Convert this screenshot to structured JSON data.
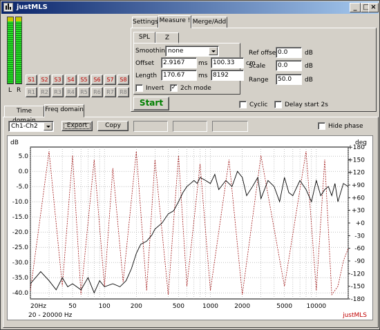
{
  "window": {
    "title": "justMLS",
    "controls": {
      "minimize": "_",
      "maximize": "□",
      "close": "×"
    }
  },
  "meters": {
    "left_label": "L",
    "right_label": "R"
  },
  "channel_buttons": {
    "s_row": [
      "S1",
      "S2",
      "S3",
      "S4",
      "S5",
      "S6",
      "S7",
      "S8"
    ],
    "r_row": [
      "R1",
      "R2",
      "R3",
      "R4",
      "R5",
      "R6",
      "R7",
      "R8"
    ]
  },
  "main_tabs": [
    "Settings",
    "Measure !",
    "Merge/Add"
  ],
  "sub_tabs": [
    "SPL",
    "Z"
  ],
  "measure": {
    "smoothing_label": "Smoothing",
    "smoothing_value": "none",
    "offset_label": "Offset",
    "offset_ms": "2.9167",
    "offset_ms_unit": "ms",
    "offset_cm": "100.33",
    "offset_cm_unit": "cm",
    "length_label": "Length",
    "length_ms": "170.67",
    "length_ms_unit": "ms",
    "length_samples": "8192",
    "invert_label": "Invert",
    "invert_checked": false,
    "twoch_label": "2ch mode",
    "twoch_checked": true,
    "ref_offset_label": "Ref offset",
    "ref_offset_value": "0.0",
    "scale_label": "Scale",
    "scale_value": "0.0",
    "range_label": "Range",
    "range_value": "50.0",
    "db_unit": "dB",
    "start_label": "Start",
    "cyclic_label": "Cyclic",
    "delay_label": "Delay start 2s"
  },
  "view_tabs": [
    "Time domain",
    "Freq domain"
  ],
  "toolbar": {
    "channel_value": "Ch1-Ch2",
    "export_label": "Export",
    "copy_label": "Copy",
    "hide_phase_label": "Hide phase"
  },
  "plot": {
    "y_left_title": "dB",
    "y_right_title": "deg",
    "y_left_ticks": [
      "5.0",
      "0.0",
      "-5.0",
      "-10.0",
      "-15.0",
      "-20.0",
      "-25.0",
      "-30.0",
      "-35.0",
      "-40.0"
    ],
    "y_right_ticks": [
      "+180",
      "+150",
      "+120",
      "+90",
      "+60",
      "+30",
      "+0",
      "-30",
      "-60",
      "-90",
      "-120",
      "-150",
      "-180"
    ],
    "x_ticks": [
      "20Hz",
      "50",
      "100",
      "200",
      "500",
      "1000",
      "2000",
      "5000",
      "10000"
    ],
    "range_caption": "20    - 20000 Hz",
    "brand": "justMLS",
    "colors": {
      "magnitude": "#000000",
      "phase": "#a01010",
      "brand": "#c00000"
    }
  },
  "chart_data": {
    "type": "line",
    "title": "",
    "xlabel": "",
    "ylabel": "dB",
    "y2label": "deg",
    "xscale": "log",
    "xlim": [
      20,
      20000
    ],
    "ylim": [
      -42,
      8
    ],
    "y2lim": [
      -180,
      180
    ],
    "grid": true,
    "series": [
      {
        "axis": "left",
        "x": [
          20,
          25,
          30,
          35,
          40,
          45,
          50,
          60,
          70,
          80,
          90,
          100,
          120,
          140,
          160,
          180,
          200,
          220,
          250,
          280,
          300,
          350,
          400,
          450,
          500,
          550,
          600,
          650,
          700,
          750,
          800,
          900,
          1000,
          1100,
          1200,
          1400,
          1600,
          1800,
          2000,
          2200,
          2500,
          2800,
          3000,
          3500,
          4000,
          4500,
          5000,
          5500,
          6000,
          7000,
          8000,
          9000,
          10000,
          11000,
          12000,
          13000,
          14000,
          15000,
          16000,
          18000,
          20000
        ],
        "y": [
          -37,
          -33,
          -36,
          -39,
          -35,
          -38,
          -37,
          -39,
          -35,
          -40,
          -36,
          -38,
          -37,
          -38,
          -36,
          -32,
          -27,
          -24,
          -23,
          -21,
          -19,
          -17,
          -14,
          -13,
          -10,
          -7,
          -5,
          -4,
          -3,
          -4,
          -2,
          -3,
          -4,
          -1,
          -6,
          -3,
          -5,
          0,
          -2,
          -8,
          -5,
          -2,
          -9,
          -3,
          -5,
          -10,
          -2,
          -7,
          -8,
          -3,
          -6,
          -10,
          -3,
          -8,
          -6,
          -5,
          -8,
          -4,
          -10,
          -4,
          -5
        ]
      },
      {
        "axis": "right",
        "x": [
          20,
          30,
          40,
          50,
          60,
          80,
          100,
          120,
          150,
          200,
          250,
          300,
          400,
          500,
          600,
          800,
          1000,
          1500,
          2000,
          3000,
          5000,
          8000,
          10000,
          12000,
          14000,
          16000,
          18000,
          20000
        ],
        "y": [
          -160,
          170,
          -150,
          160,
          -170,
          150,
          -150,
          130,
          -140,
          170,
          -160,
          150,
          -170,
          160,
          -150,
          140,
          -160,
          150,
          -170,
          160,
          -150,
          170,
          -160,
          150,
          -170,
          -150,
          -90,
          -60
        ]
      }
    ]
  }
}
